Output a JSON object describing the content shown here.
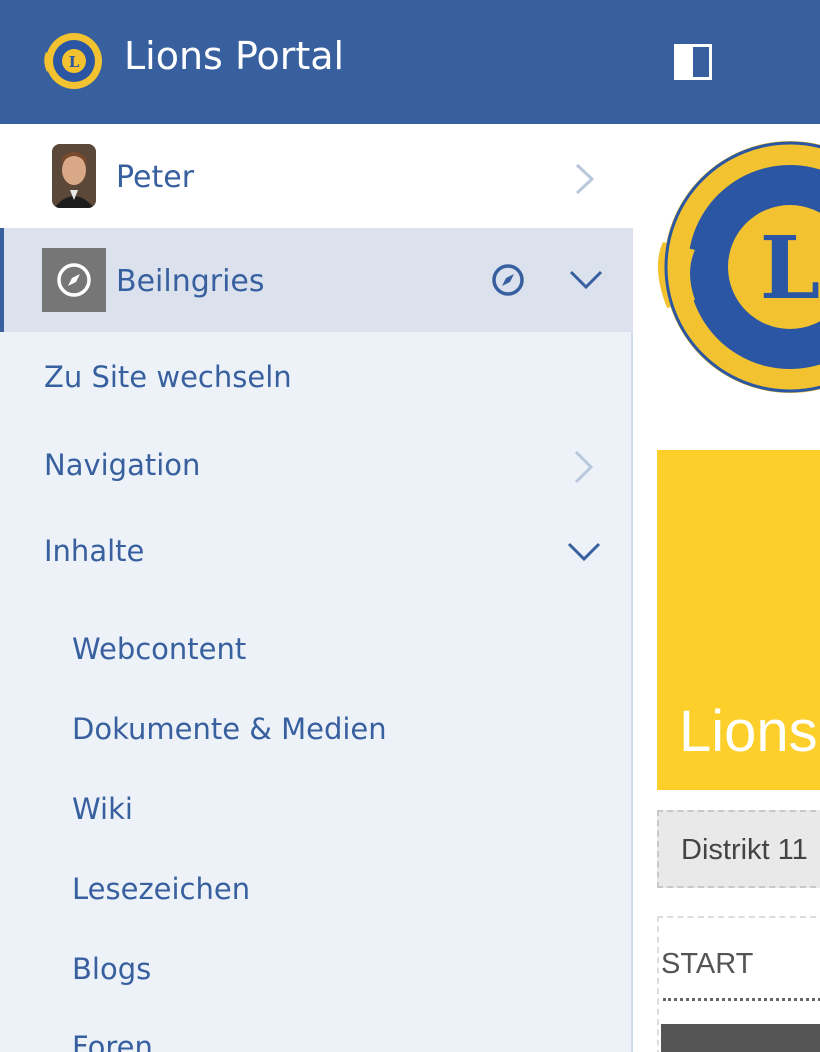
{
  "header": {
    "title": "Lions Portal",
    "logo_icon": "lions-logo-icon",
    "toggle_icon": "sidebar-toggle-icon"
  },
  "sidebar": {
    "user": {
      "name": "Peter",
      "avatar": "avatar",
      "chevron": "chevron-right-icon"
    },
    "site": {
      "name": "Beilngries",
      "icon": "compass-icon",
      "chevron": "chevron-down-icon"
    },
    "items": [
      {
        "label": "Zu Site wechseln"
      },
      {
        "label": "Navigation",
        "chevron": "chevron-right-icon"
      },
      {
        "label": "Inhalte",
        "chevron": "chevron-down-icon"
      }
    ],
    "subitems": [
      {
        "label": "Webcontent"
      },
      {
        "label": "Dokumente & Medien"
      },
      {
        "label": "Wiki"
      },
      {
        "label": "Lesezeichen"
      },
      {
        "label": "Blogs"
      },
      {
        "label": "Foren"
      }
    ]
  },
  "content": {
    "banner_text": "Lions",
    "distrikt_text": "Distrikt 11",
    "start_text": "START"
  },
  "colors": {
    "header_bg": "#38609f",
    "sidebar_bg": "#edf2f9",
    "active_row_bg": "#dbe2ee",
    "link": "#38609f",
    "banner": "#fccf2b"
  }
}
